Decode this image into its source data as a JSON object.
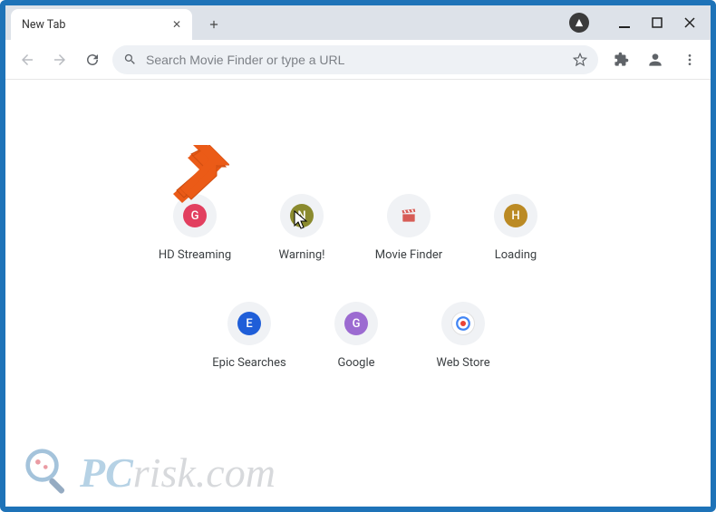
{
  "tab": {
    "title": "New Tab"
  },
  "omnibox": {
    "placeholder": "Search Movie Finder or type a URL"
  },
  "shortcuts": [
    {
      "label": "HD Streaming",
      "letter": "G",
      "bg": "#e23f5f"
    },
    {
      "label": "Warning!",
      "letter": "N",
      "bg": "#8a8a2e"
    },
    {
      "label": "Movie Finder",
      "letter": "",
      "bg": "#f0f2f5"
    },
    {
      "label": "Loading",
      "letter": "H",
      "bg": "#bb8a24"
    },
    {
      "label": "Epic Searches",
      "letter": "E",
      "bg": "#1f5ed8"
    },
    {
      "label": "Google",
      "letter": "G",
      "bg": "#9c6bd1"
    },
    {
      "label": "Web Store",
      "letter": "",
      "bg": "#ffffff"
    }
  ],
  "watermark": {
    "brand_first": "PC",
    "brand_rest": "risk.com"
  }
}
